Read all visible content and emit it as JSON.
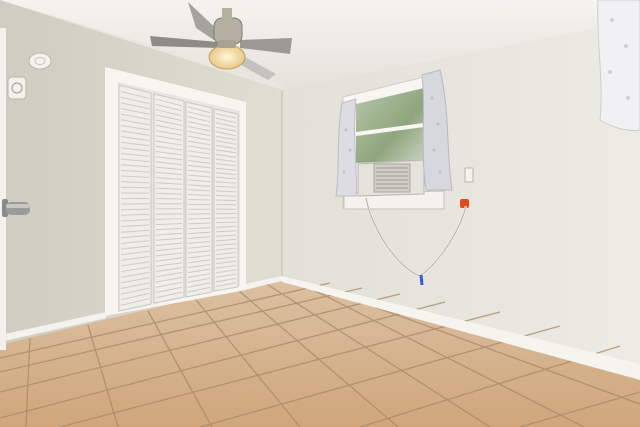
{
  "scene": {
    "subject": "empty bedroom",
    "colors": {
      "left_wall": "#dcdacf",
      "back_wall": "#e6e4db",
      "right_wall": "#e9e7df",
      "ceiling": "#eeede8",
      "floor_tile": "#d8b48c",
      "grout": "#9c7e63",
      "baseboard": "#f4f3ee",
      "closet_door": "#f1f0eb",
      "window_frame": "#f7f6f2",
      "curtain": "#d9d9de",
      "cord_plug": "#e0491f"
    },
    "icons": [
      "ceiling-fan-icon",
      "closet-door-icon",
      "window-icon",
      "air-conditioner-icon",
      "door-handle-icon",
      "thermostat-icon",
      "smoke-detector-icon",
      "outlet-icon"
    ]
  }
}
